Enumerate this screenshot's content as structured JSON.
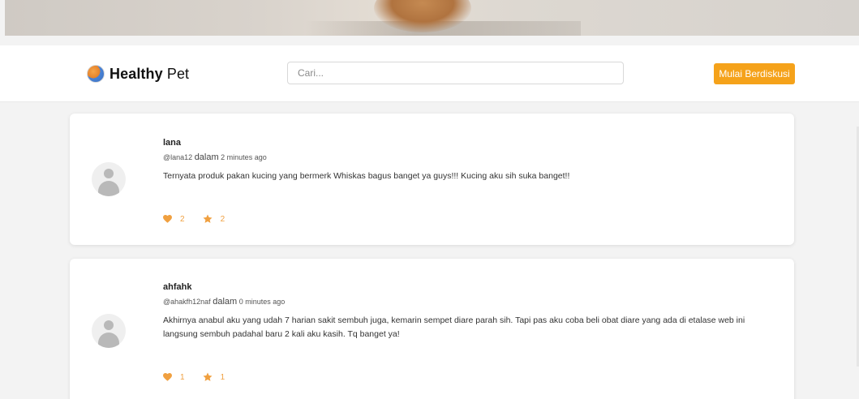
{
  "brand": {
    "name_bold": "Healthy",
    "name_rest": " Pet"
  },
  "search": {
    "placeholder": "Cari..."
  },
  "nav": {
    "cta_label": "Mulai Berdiskusi"
  },
  "colors": {
    "accent": "#f5a21a",
    "icon": "#f0a040"
  },
  "posts": [
    {
      "username": "lana",
      "handle": "@lana12",
      "dalam": "dalam",
      "time": "2 minutes ago",
      "text": "Ternyata produk pakan kucing yang bermerk Whiskas bagus banget ya guys!!! Kucing aku sih suka banget!!",
      "likes": "2",
      "stars": "2",
      "like_icon": "heart-icon",
      "star_icon": "star-icon"
    },
    {
      "username": "ahfahk",
      "handle": "@ahakfh12naf",
      "dalam": "dalam",
      "time": "0 minutes ago",
      "text": "Akhirnya anabul aku yang udah 7 harian sakit sembuh juga, kemarin sempet diare parah sih. Tapi pas aku coba beli obat diare yang ada di etalase web ini langsung sembuh padahal baru 2 kali aku kasih. Tq banget ya!",
      "likes": "1",
      "stars": "1",
      "like_icon": "heart-icon",
      "star_icon": "star-icon"
    }
  ]
}
